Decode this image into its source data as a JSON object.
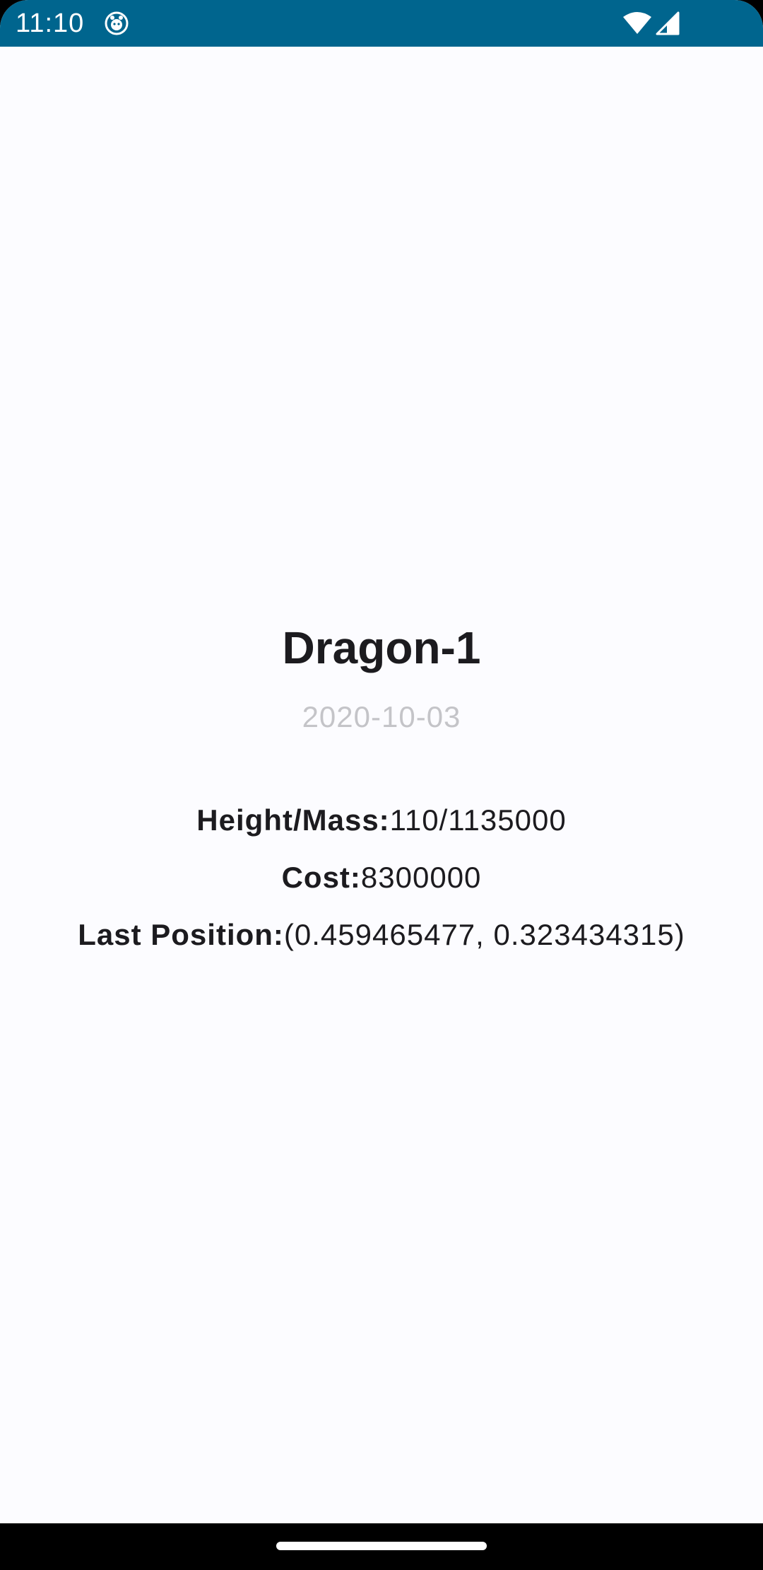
{
  "status_bar": {
    "time": "11:10",
    "background_color": "#00658e",
    "icons": [
      "app-notification-icon",
      "wifi-icon",
      "cell-signal-icon"
    ]
  },
  "detail": {
    "title": "Dragon-1",
    "date": "2020-10-03",
    "height_mass_label": "Height/Mass:",
    "height_mass_value": "110/1135000",
    "cost_label": "Cost:",
    "cost_value": "8300000",
    "last_position_label": "Last Position:",
    "last_position_value": "(0.459465477, 0.323434315)"
  },
  "colors": {
    "background": "#fcfcff",
    "text_primary": "#1c1b1f",
    "text_secondary": "#c4c4c8"
  }
}
